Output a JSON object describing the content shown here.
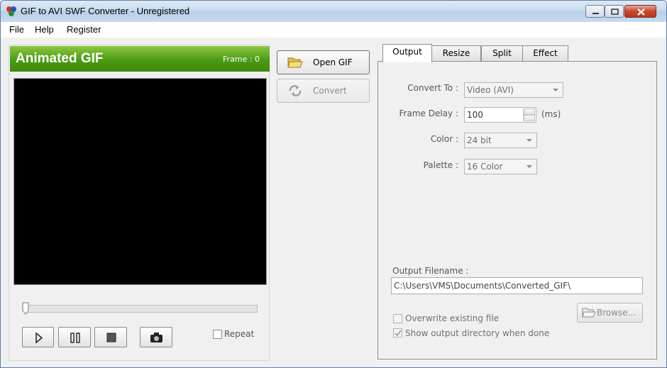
{
  "window": {
    "title": "GIF to AVI SWF Converter - Unregistered",
    "accent": "#4b9b14"
  },
  "menu": [
    "File",
    "Help",
    "Register"
  ],
  "preview": {
    "title": "Animated GIF",
    "frame_label": "Frame : 0",
    "repeat_label": "Repeat",
    "seek_position": 0
  },
  "actions": {
    "open_label": "Open GIF",
    "convert_label": "Convert"
  },
  "tabs": [
    "Output",
    "Resize",
    "Split",
    "Effect"
  ],
  "output": {
    "convert_to_label": "Convert To :",
    "convert_to_value": "Video (AVI)",
    "frame_delay_label": "Frame Delay :",
    "frame_delay_value": "100",
    "frame_delay_unit": "(ms)",
    "color_label": "Color :",
    "color_value": "24 bit",
    "palette_label": "Palette :",
    "palette_value": "16 Color",
    "filename_label": "Output Filename :",
    "filename_value": "C:\\Users\\VMS\\Documents\\Converted_GIF\\",
    "browse_label": "Browse...",
    "overwrite_label": "Overwrite existing file",
    "overwrite_checked": false,
    "show_dir_label": "Show output directory when done",
    "show_dir_checked": true
  }
}
